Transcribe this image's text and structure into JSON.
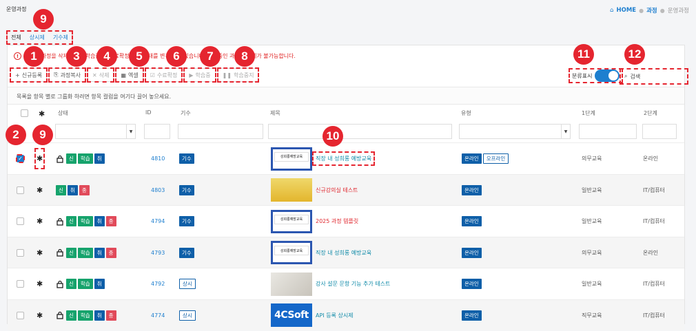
{
  "header": {
    "title": "운영과정",
    "breadcrumb": [
      "HOME",
      "과정",
      "운영과정"
    ]
  },
  "tabs": [
    "전체",
    "상시제",
    "기수제"
  ],
  "notice": "선택된 과정을 삭제하거나 학습중 및 수료확정 등의 상태를 변경할 수 있습니다. 학습중인 과정은 삭제가 불가능합니다.",
  "toolbar": {
    "new": "신규등록",
    "copy": "과정복사",
    "delete": "삭제",
    "excel": "엑셀",
    "complete": "수료확정",
    "learning": "학습중",
    "stop": "학습중지"
  },
  "switch_label": "분류표시",
  "search_label": "검색",
  "group_hint": "목록을 항목 별로 그룹화 하려면 항목 컬럼을 여기다 끌어 놓으세요.",
  "columns": [
    "상태",
    "ID",
    "기수",
    "제목",
    "유형",
    "1단계",
    "2단계"
  ],
  "rows": [
    {
      "badges": [
        "신",
        "학습",
        "취"
      ],
      "id": "4810",
      "kind": "기수",
      "title": "직장 내 성희롱 예방교육",
      "types": [
        "온라인",
        "오프라인"
      ],
      "s1": "의무교육",
      "s2": "온라인"
    },
    {
      "badges": [
        "신",
        "취",
        "종"
      ],
      "id": "4803",
      "kind": "기수",
      "title": "신규강의실 테스트",
      "types": [
        "온라인"
      ],
      "s1": "일반교육",
      "s2": "IT/컴퓨터"
    },
    {
      "badges": [
        "신",
        "학습",
        "취",
        "종"
      ],
      "id": "4794",
      "kind": "기수",
      "title": "2025 과정 템플릿",
      "types": [
        "온라인"
      ],
      "s1": "일반교육",
      "s2": "IT/컴퓨터"
    },
    {
      "badges": [
        "신",
        "학습",
        "취",
        "종"
      ],
      "id": "4793",
      "kind": "기수",
      "title": "직장 내 성희롱 예방교육",
      "types": [
        "온라인"
      ],
      "s1": "의무교육",
      "s2": "온라인"
    },
    {
      "badges": [
        "신",
        "학습",
        "취"
      ],
      "id": "4792",
      "kind": "상시",
      "title": "강사 설문 문항 기능 추가 테스트",
      "types": [
        "온라인"
      ],
      "s1": "일반교육",
      "s2": "IT/컴퓨터"
    },
    {
      "badges": [
        "신",
        "학습",
        "취",
        "종"
      ],
      "id": "4774",
      "kind": "상시",
      "title": "API 등록 상시제",
      "types": [
        "온라인"
      ],
      "s1": "직무교육",
      "s2": "IT/컴퓨터"
    }
  ],
  "thumb_text": {
    "poster": "성희롱예방교육",
    "logo": "4CSoft"
  },
  "markers": [
    "1",
    "2",
    "3",
    "4",
    "5",
    "6",
    "7",
    "8",
    "9",
    "9",
    "10",
    "11",
    "12"
  ],
  "colors": {
    "accent": "#1e7fcf",
    "marker": "#e5252f"
  }
}
